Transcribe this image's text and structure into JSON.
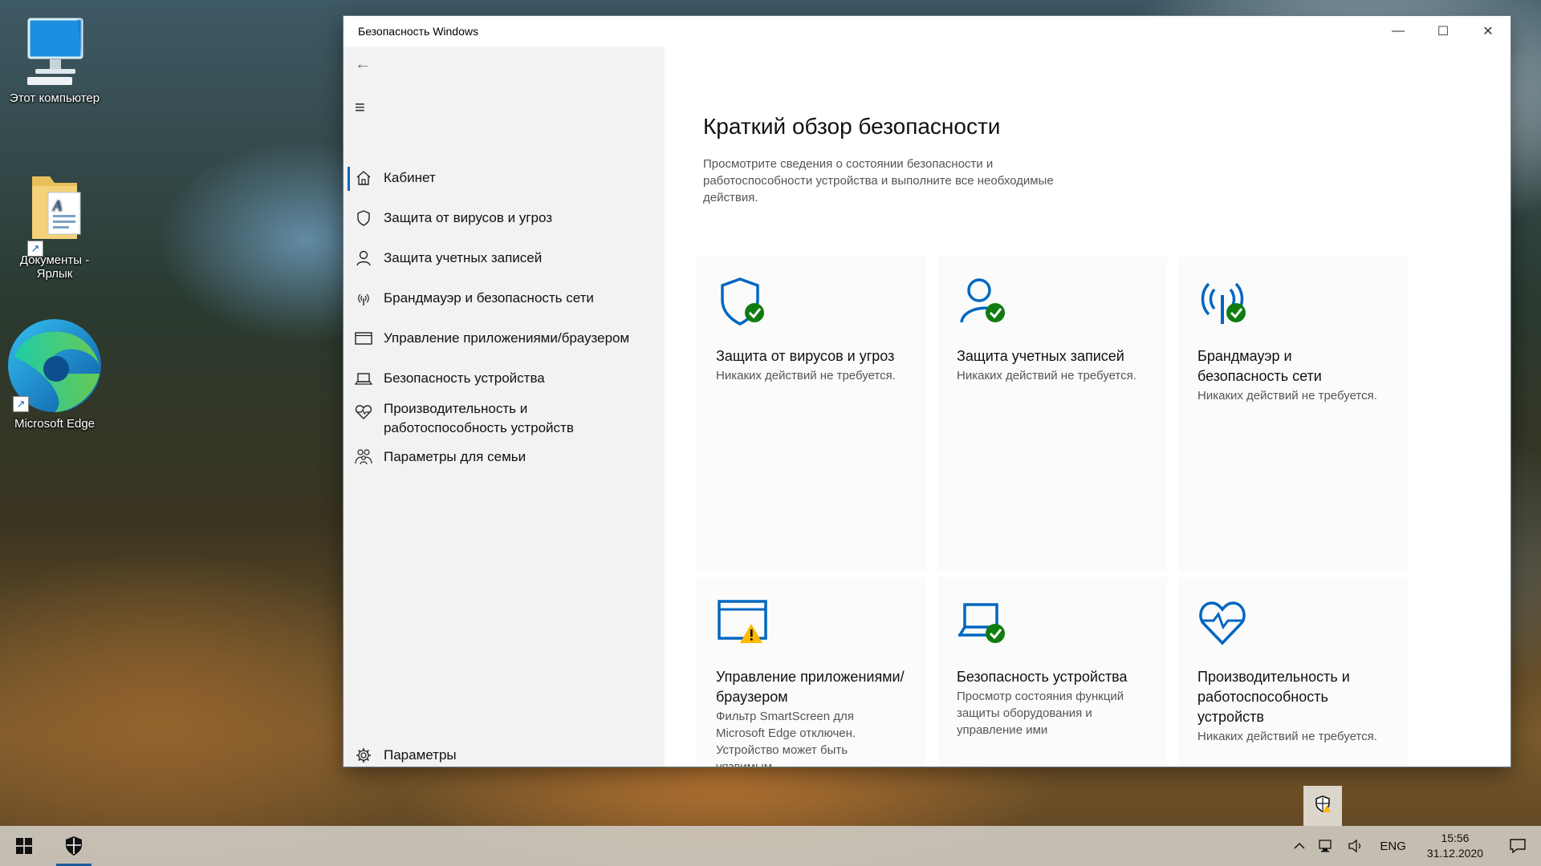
{
  "desktop": {
    "icons": [
      {
        "label": "Этот компьютер",
        "icon": "computer-icon"
      },
      {
        "label": "Документы - Ярлык",
        "icon": "folder-shortcut-icon"
      },
      {
        "label": "Microsoft Edge",
        "icon": "edge-icon"
      }
    ]
  },
  "window": {
    "title": "Безопасность Windows",
    "controls": {
      "minimize": "—",
      "maximize": "☐",
      "close": "✕"
    }
  },
  "sidebar": {
    "back": "←",
    "menu": "≡",
    "items": [
      {
        "label": "Кабинет",
        "icon": "home-icon",
        "active": true
      },
      {
        "label": "Защита от вирусов и угроз",
        "icon": "shield-icon"
      },
      {
        "label": "Защита учетных записей",
        "icon": "person-icon"
      },
      {
        "label": "Брандмауэр и безопасность сети",
        "icon": "antenna-icon"
      },
      {
        "label": "Управление приложениями/браузером",
        "icon": "app-browser-icon"
      },
      {
        "label": "Безопасность устройства",
        "icon": "laptop-icon"
      },
      {
        "label": "Производительность и работоспособность устройств",
        "icon": "heart-icon"
      },
      {
        "label": "Параметры для семьи",
        "icon": "family-icon"
      }
    ],
    "settings": "Параметры"
  },
  "main": {
    "title": "Краткий обзор безопасности",
    "subtitle": "Просмотрите сведения о состоянии безопасности и работоспособности устройства и выполните все необходимые действия.",
    "tiles": [
      {
        "title": "Защита от вирусов и угроз",
        "desc": "Никаких действий не требуется.",
        "status": "ok",
        "icon": "shield-icon"
      },
      {
        "title": "Защита учетных записей",
        "desc": "Никаких действий не требуется.",
        "status": "ok",
        "icon": "person-icon"
      },
      {
        "title": "Брандмауэр и безопасность сети",
        "desc": "Никаких действий не требуется.",
        "status": "ok",
        "icon": "antenna-icon"
      },
      {
        "title": "Управление приложениями/браузером",
        "desc": "Фильтр SmartScreen для Microsoft Edge отключен. Устройство может быть уязвимым.",
        "status": "warning",
        "icon": "app-browser-icon"
      },
      {
        "title": "Безопасность устройства",
        "desc": "Просмотр состояния функций защиты оборудования и управление ими",
        "status": "ok",
        "icon": "laptop-icon"
      },
      {
        "title": "Производительность и работоспособность устройств",
        "desc": "Никаких действий не требуется.",
        "status": "none",
        "icon": "heart-icon"
      }
    ]
  },
  "taskbar": {
    "language": "ENG",
    "time": "15:56",
    "date": "31.12.2020"
  },
  "colors": {
    "accent": "#0067c0",
    "ok": "#107c10",
    "warning": "#ffb900"
  }
}
